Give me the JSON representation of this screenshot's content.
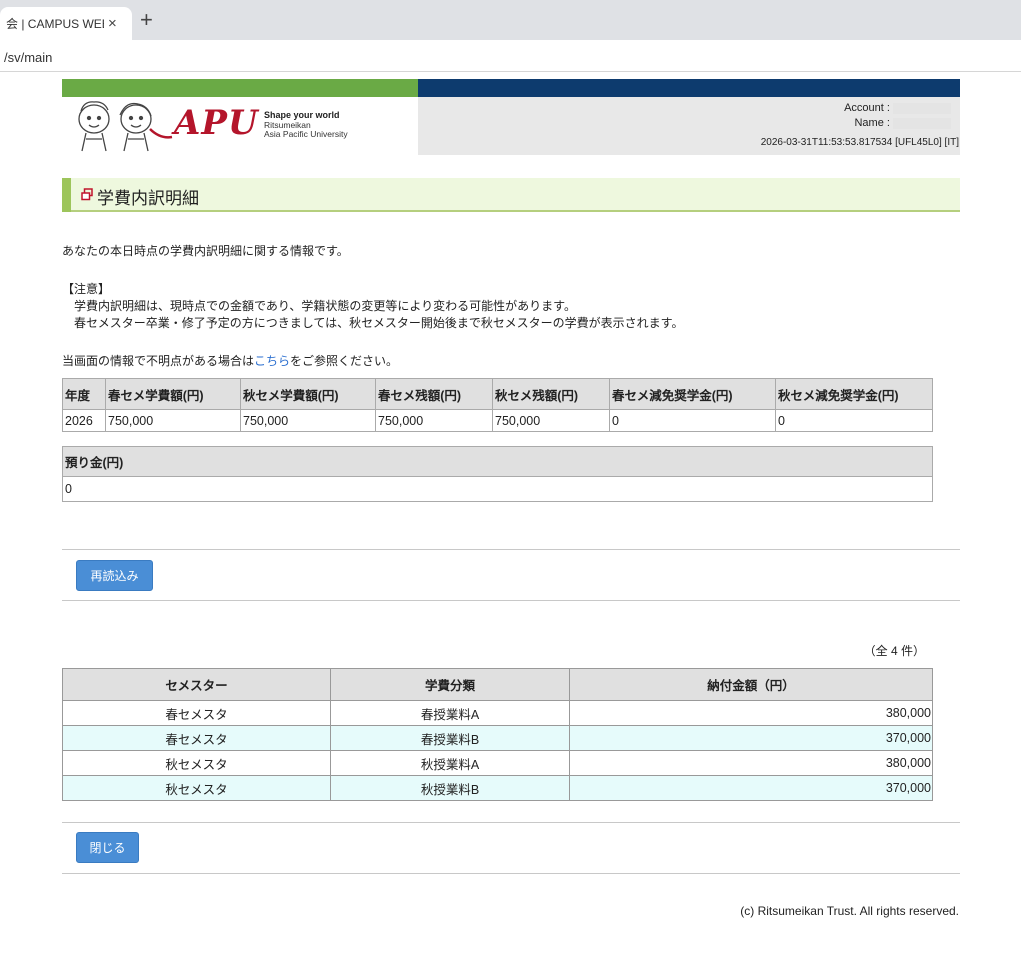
{
  "browser": {
    "tab_title": "会 | CAMPUS WEB",
    "tab_close": "×",
    "new_tab": "+",
    "url": "/sv/main"
  },
  "header": {
    "logo_text": "APU",
    "tagline": "Shape your world",
    "university_line1": "Ritsumeikan",
    "university_line2": "Asia Pacific University",
    "account_label": "Account :",
    "name_label": "Name :",
    "timestamp": "2026-03-31T11:53:53.817534 [UFL45L0] [IT]"
  },
  "page": {
    "title": "学費内訳明細",
    "intro": "あなたの本日時点の学費内訳明細に関する情報です。",
    "notice_heading": "【注意】",
    "notice_line1": "学費内訳明細は、現時点での金額であり、学籍状態の変更等により変わる可能性があります。",
    "notice_line2": "春セメスター卒業・修了予定の方につきましては、秋セメスター開始後まで秋セメスターの学費が表示されます。",
    "inquiry_prefix": "当画面の情報で不明点がある場合は",
    "inquiry_link": "こちら",
    "inquiry_suffix": "をご参照ください。"
  },
  "summary_table": {
    "headers": [
      "年度",
      "春セメ学費額(円)",
      "秋セメ学費額(円)",
      "春セメ残額(円)",
      "秋セメ残額(円)",
      "春セメ減免奨学金(円)",
      "秋セメ減免奨学金(円)"
    ],
    "row": [
      "2026",
      "750,000",
      "750,000",
      "750,000",
      "750,000",
      "0",
      "0"
    ]
  },
  "deposit_table": {
    "header": "預り金(円)",
    "value": "0"
  },
  "buttons": {
    "reload": "再読込み",
    "close": "閉じる"
  },
  "detail_table": {
    "count": "（全 4 件）",
    "headers": [
      "セメスター",
      "学費分類",
      "納付金額（円）"
    ],
    "rows": [
      [
        "春セメスタ",
        "春授業料A",
        "380,000"
      ],
      [
        "春セメスタ",
        "春授業料B",
        "370,000"
      ],
      [
        "秋セメスタ",
        "秋授業料A",
        "380,000"
      ],
      [
        "秋セメスタ",
        "秋授業料B",
        "370,000"
      ]
    ]
  },
  "footer": "(c) Ritsumeikan Trust. All rights reserved.",
  "colors": {
    "brand_red": "#b4152b",
    "header_green": "#6aaa45",
    "header_navy": "#0d3b6e",
    "button_blue": "#4a8ed6",
    "link_blue": "#2a6ecf",
    "row_highlight": "#e6fbfb"
  }
}
